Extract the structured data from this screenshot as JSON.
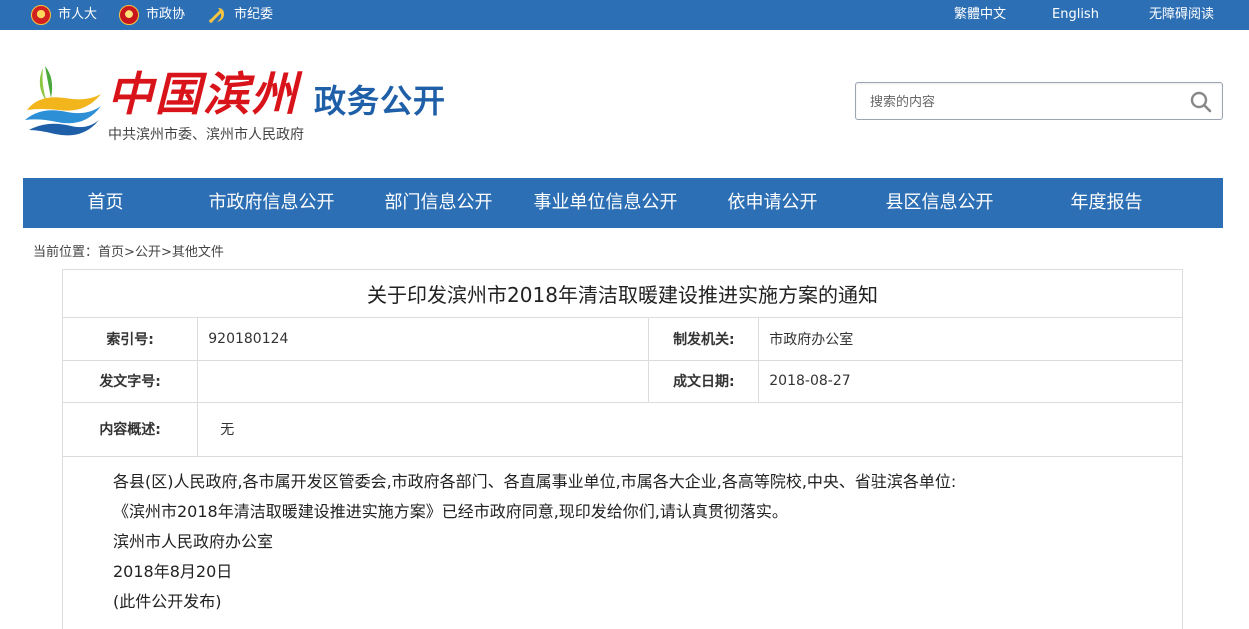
{
  "topbar": {
    "left_links": [
      {
        "label": "市人大",
        "icon": "npc-emblem-icon"
      },
      {
        "label": "市政协",
        "icon": "cppcc-emblem-icon"
      },
      {
        "label": "市纪委",
        "icon": "party-emblem-icon"
      }
    ],
    "right_links": [
      "繁體中文",
      "English",
      "无障碍阅读"
    ]
  },
  "header": {
    "logo_title": "中国滨州",
    "logo_subtitle": "政务公开",
    "logo_caption": "中共滨州市委、滨州市人民政府",
    "search_placeholder": "搜索的内容"
  },
  "nav": {
    "items": [
      "首页",
      "市政府信息公开",
      "部门信息公开",
      "事业单位信息公开",
      "依申请公开",
      "县区信息公开",
      "年度报告"
    ]
  },
  "breadcrumb": {
    "prefix": "当前位置：",
    "items": [
      "首页",
      "公开",
      "其他文件"
    ],
    "separator": ">"
  },
  "document": {
    "title": "关于印发滨州市2018年清洁取暖建设推进实施方案的通知",
    "meta": {
      "index_label": "索引号:",
      "index_value": "920180124",
      "issuer_label": "制发机关:",
      "issuer_value": "市政府办公室",
      "docno_label": "发文字号:",
      "docno_value": "",
      "date_label": "成文日期:",
      "date_value": "2018-08-27",
      "summary_label": "内容概述:",
      "summary_value": "无"
    },
    "paragraphs": [
      "各县(区)人民政府,各市属开发区管委会,市政府各部门、各直属事业单位,市属各大企业,各高等院校,中央、省驻滨各单位:",
      "《滨州市2018年清洁取暖建设推进实施方案》已经市政府同意,现印发给你们,请认真贯彻落实。",
      "滨州市人民政府办公室",
      "2018年8月20日",
      "(此件公开发布)"
    ]
  },
  "colors": {
    "brand_blue": "#2d6fb4",
    "logo_red": "#d8141a",
    "logo_blue": "#1e5fa8"
  }
}
